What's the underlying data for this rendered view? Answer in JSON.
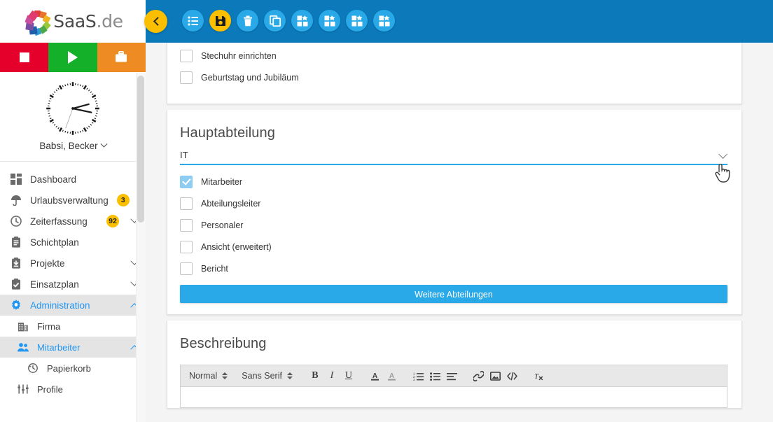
{
  "brand": {
    "name_main": "SaaS",
    "name_tld": ".de"
  },
  "quick_actions": [
    {
      "name": "stop-button",
      "icon": "stop-icon",
      "color": "#e4002b"
    },
    {
      "name": "play-button",
      "icon": "play-icon",
      "color": "#14b02a"
    },
    {
      "name": "briefcase-button",
      "icon": "briefcase-icon",
      "color": "#ee8b22"
    }
  ],
  "user": {
    "name": "Babsi, Becker"
  },
  "sidebar": {
    "items": [
      {
        "label": "Dashboard",
        "icon": "dashboard-icon",
        "badge": "",
        "caret": "",
        "active": false,
        "level": 0
      },
      {
        "label": "Urlaubsverwaltung",
        "icon": "umbrella-icon",
        "badge": "3",
        "caret": "down",
        "active": false,
        "level": 0
      },
      {
        "label": "Zeiterfassung",
        "icon": "clock-icon",
        "badge": "92",
        "caret": "down",
        "active": false,
        "level": 0
      },
      {
        "label": "Schichtplan",
        "icon": "clipboard-icon",
        "badge": "",
        "caret": "",
        "active": false,
        "level": 0
      },
      {
        "label": "Projekte",
        "icon": "projects-icon",
        "badge": "",
        "caret": "down",
        "active": false,
        "level": 0
      },
      {
        "label": "Einsatzplan",
        "icon": "checklist-icon",
        "badge": "",
        "caret": "down",
        "active": false,
        "level": 0
      },
      {
        "label": "Administration",
        "icon": "gear-icon",
        "badge": "",
        "caret": "up",
        "active": true,
        "level": 0
      },
      {
        "label": "Firma",
        "icon": "building-icon",
        "badge": "",
        "caret": "",
        "active": false,
        "level": 1
      },
      {
        "label": "Mitarbeiter",
        "icon": "users-icon",
        "badge": "",
        "caret": "up",
        "active": true,
        "level": 1
      },
      {
        "label": "Papierkorb",
        "icon": "restore-icon",
        "badge": "",
        "caret": "",
        "active": false,
        "level": 2
      },
      {
        "label": "Profile",
        "icon": "sliders-icon",
        "badge": "",
        "caret": "",
        "active": false,
        "level": 1
      }
    ]
  },
  "toolbar": {
    "back_label": "back",
    "buttons": [
      {
        "name": "list-button",
        "icon": "list-icon",
        "style": "blue"
      },
      {
        "name": "save-button",
        "icon": "save-icon",
        "style": "yellow"
      },
      {
        "name": "delete-button",
        "icon": "trash-icon",
        "style": "blue"
      },
      {
        "name": "duplicate-button",
        "icon": "copy-icon",
        "style": "blue"
      },
      {
        "name": "widget-button-1",
        "icon": "puzzle-icon",
        "style": "blue"
      },
      {
        "name": "widget-button-2",
        "icon": "puzzle-icon",
        "style": "blue"
      },
      {
        "name": "widget-button-3",
        "icon": "puzzle-icon",
        "style": "blue"
      },
      {
        "name": "widget-button-4",
        "icon": "puzzle-icon",
        "style": "blue"
      }
    ]
  },
  "top_card": {
    "options": [
      {
        "label": "Stechuhr einrichten",
        "checked": false
      },
      {
        "label": "Geburtstag und Jubiläum",
        "checked": false
      }
    ]
  },
  "hauptabteilung": {
    "title": "Hauptabteilung",
    "select_value": "IT",
    "roles": [
      {
        "label": "Mitarbeiter",
        "checked": true
      },
      {
        "label": "Abteilungsleiter",
        "checked": false
      },
      {
        "label": "Personaler",
        "checked": false
      },
      {
        "label": "Ansicht (erweitert)",
        "checked": false
      },
      {
        "label": "Bericht",
        "checked": false
      }
    ],
    "more_button": "Weitere Abteilungen"
  },
  "beschreibung": {
    "title": "Beschreibung",
    "editor": {
      "format_label": "Normal",
      "font_label": "Sans Serif",
      "buttons": [
        {
          "name": "bold-button",
          "glyph": "B"
        },
        {
          "name": "italic-button",
          "glyph": "I"
        },
        {
          "name": "underline-button",
          "glyph": "U"
        }
      ],
      "content": ""
    }
  },
  "colors": {
    "topbar": "#0b79ba",
    "accent_blue": "#29a9e8",
    "accent_yellow": "#fcbf00",
    "link_blue": "#2196f3",
    "page_bg": "#f4f4f4"
  }
}
